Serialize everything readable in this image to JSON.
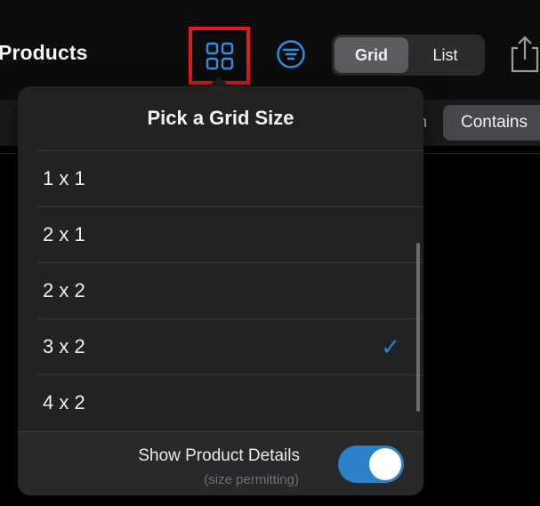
{
  "header": {
    "title": "Products",
    "view_toggle": {
      "options": [
        "Grid",
        "List"
      ],
      "selected": "Grid"
    }
  },
  "filterbar": {
    "contains_label": "Contains",
    "partial_glyph": "n"
  },
  "popover": {
    "title": "Pick a Grid Size",
    "options": [
      {
        "label": "1 x 1",
        "selected": false
      },
      {
        "label": "2 x 1",
        "selected": false
      },
      {
        "label": "2 x 2",
        "selected": false
      },
      {
        "label": "3 x 2",
        "selected": true
      },
      {
        "label": "4 x 2",
        "selected": false
      }
    ],
    "check_glyph": "✓",
    "details": {
      "label": "Show Product Details",
      "sublabel": "(size permitting)",
      "enabled": true
    }
  },
  "colors": {
    "accent": "#2b82c9",
    "highlight_border": "#e01b1b",
    "checkmark": "#2f7fcf"
  },
  "icons": {
    "grid_button": "grid-icon",
    "filter_button": "filter-icon",
    "share_button": "share-icon"
  }
}
